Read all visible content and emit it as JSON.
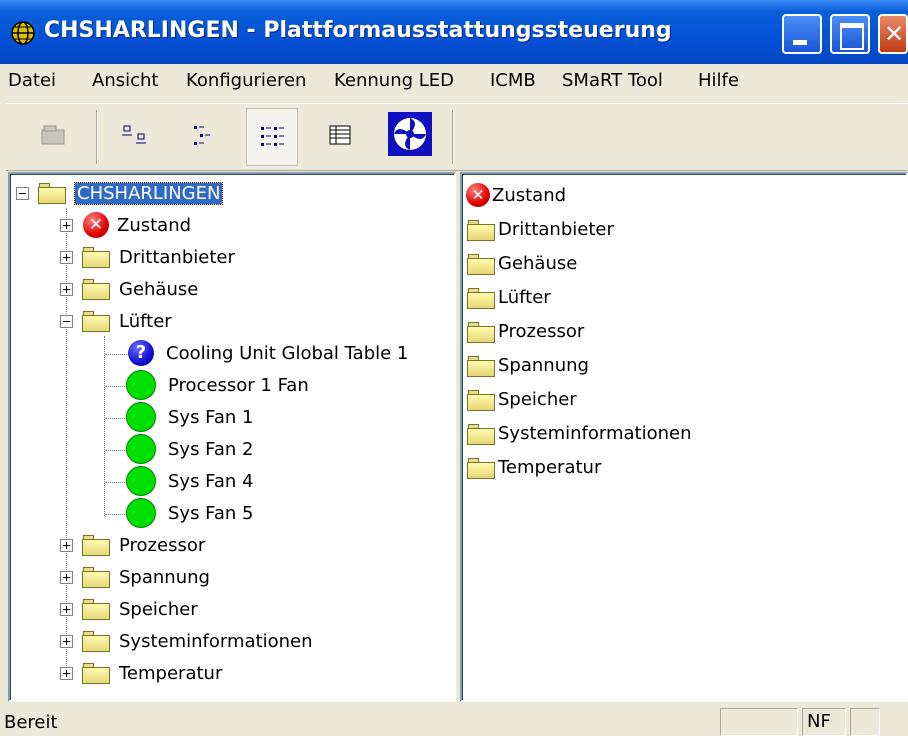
{
  "window": {
    "title": "CHSHARLINGEN - Plattformausstattungssteuerung"
  },
  "menu": [
    "Datei",
    "Ansicht",
    "Konfigurieren",
    "Kennung LED",
    "ICMB",
    "SMaRT Tool",
    "Hilfe"
  ],
  "toolbar": {
    "buttons": [
      "open-icon",
      "large-icons-view-icon",
      "small-icons-view-icon",
      "list-view-icon",
      "details-view-icon",
      "fan-icon"
    ]
  },
  "tree": {
    "root": "CHSHARLINGEN",
    "items": [
      {
        "label": "Zustand",
        "icon": "error-icon"
      },
      {
        "label": "Drittanbieter",
        "icon": "folder-icon"
      },
      {
        "label": "Gehäuse",
        "icon": "folder-icon"
      },
      {
        "label": "Lüfter",
        "icon": "folder-icon",
        "expanded": true
      },
      {
        "label": "Prozessor",
        "icon": "folder-icon"
      },
      {
        "label": "Spannung",
        "icon": "folder-icon"
      },
      {
        "label": "Speicher",
        "icon": "folder-icon"
      },
      {
        "label": "Systeminformationen",
        "icon": "folder-icon"
      },
      {
        "label": "Temperatur",
        "icon": "folder-icon"
      }
    ],
    "fans": [
      {
        "label": "Cooling Unit Global Table 1",
        "icon": "question-icon"
      },
      {
        "label": "Processor 1 Fan",
        "icon": "ok-status-icon"
      },
      {
        "label": "Sys Fan 1",
        "icon": "ok-status-icon"
      },
      {
        "label": "Sys Fan 2",
        "icon": "ok-status-icon"
      },
      {
        "label": "Sys Fan 4",
        "icon": "ok-status-icon"
      },
      {
        "label": "Sys Fan 5",
        "icon": "ok-status-icon"
      }
    ]
  },
  "list": {
    "items": [
      "Zustand",
      "Drittanbieter",
      "Gehäuse",
      "Lüfter",
      "Prozessor",
      "Spannung",
      "Speicher",
      "Systeminformationen",
      "Temperatur"
    ]
  },
  "status": {
    "text": "Bereit",
    "indicator": "NF"
  },
  "colors": {
    "titlebar": "#0551d6",
    "selection": "#316ac5",
    "ok": "#00e000",
    "error": "#e00000"
  }
}
